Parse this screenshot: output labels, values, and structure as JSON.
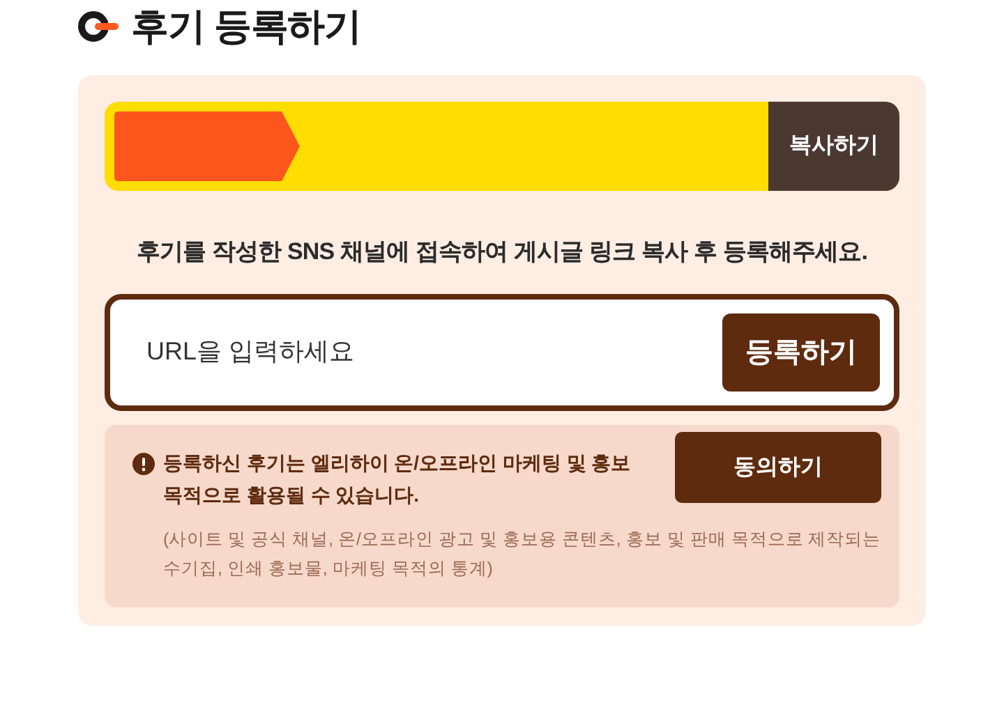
{
  "title": "후기 등록하기",
  "copy_bar": {
    "button": "복사하기"
  },
  "instruction": "후기를 작성한 SNS 채널에 접속하여 게시글 링크 복사 후 등록해주세요.",
  "url_field": {
    "placeholder": "URL을 입력하세요",
    "button": "등록하기"
  },
  "consent": {
    "notice": "등록하신 후기는 엘리하이 온/오프라인 마케팅 및 홍보 목적으로 활용될 수 있습니다.",
    "detail": "(사이트 및 공식 채널, 온/오프라인 광고 및 홍보용 콘텐츠, 홍보 및 판매 목적으로 제작되는 수기집, 인쇄 홍보물, 마케팅 목적의 통계)",
    "button": "동의하기"
  }
}
